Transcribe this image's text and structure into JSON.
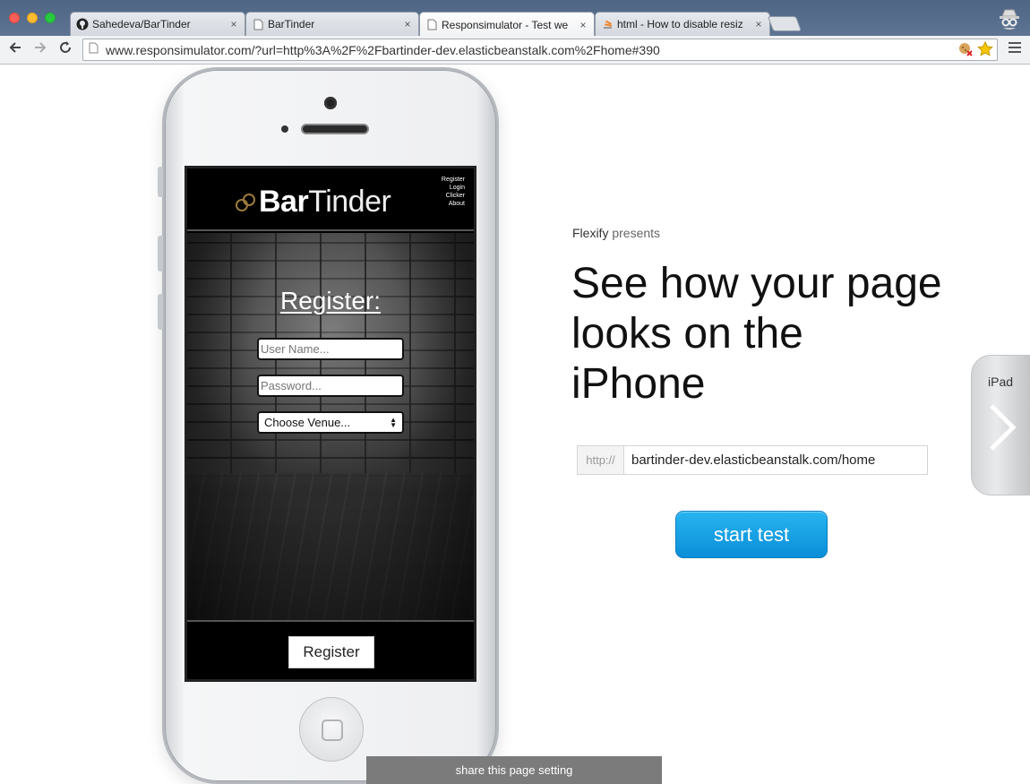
{
  "browser": {
    "tabs": [
      {
        "title": "Sahedeva/BarTinder",
        "icon": "github-icon"
      },
      {
        "title": "BarTinder",
        "icon": "page-icon"
      },
      {
        "title": "Responsimulator - Test we",
        "icon": "page-icon",
        "active": true
      },
      {
        "title": "html - How to disable resiz",
        "icon": "stackoverflow-icon"
      }
    ],
    "url": "www.responsimulator.com/?url=http%3A%2F%2Fbartinder-dev.elasticbeanstalk.com%2Fhome#390",
    "close_glyph": "×"
  },
  "app": {
    "logo_bold": "Bar",
    "logo_light": "Tinder",
    "nav": [
      "Register",
      "Login",
      "Clicker",
      "About"
    ],
    "heading": "Register:",
    "username_placeholder": "User Name...",
    "password_placeholder": "Password...",
    "venue_select": "Choose Venue...",
    "register_button": "Register"
  },
  "main": {
    "presents_brand": "Flexify",
    "presents_suffix": " presents",
    "headline": "See how your page looks on the iPhone",
    "url_prefix": "http://",
    "url_value": "bartinder-dev.elasticbeanstalk.com/home",
    "start_button": "start test",
    "ipad_label": "iPad",
    "share_bar": "share this page setting"
  },
  "colors": {
    "chrome_blue": "#5a6e8c",
    "start_button": "#0a8ed8",
    "share_bar": "#7b7b7b"
  }
}
